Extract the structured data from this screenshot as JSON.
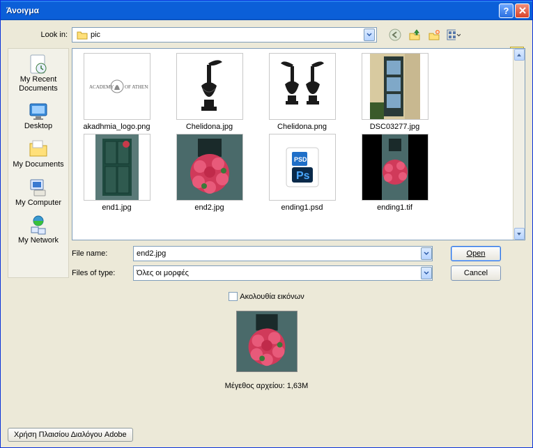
{
  "window": {
    "title": "Άνοιγμα"
  },
  "lookin": {
    "label": "Look in:",
    "value": "pic"
  },
  "places": {
    "recent": "My Recent\nDocuments",
    "desktop": "Desktop",
    "mydocs": "My Documents",
    "mycomp": "My Computer",
    "mynet": "My Network"
  },
  "files": [
    {
      "name": "akadhmia_logo.png"
    },
    {
      "name": "Chelidona.jpg"
    },
    {
      "name": "Chelidona.png"
    },
    {
      "name": "DSC03277.jpg"
    },
    {
      "name": "end1.jpg"
    },
    {
      "name": "end2.jpg"
    },
    {
      "name": "ending1.psd"
    },
    {
      "name": "ending1.tif"
    }
  ],
  "fields": {
    "filename_label": "File name:",
    "filename_value": "end2.jpg",
    "filetype_label": "Files of type:",
    "filetype_value": "Όλες οι μορφές"
  },
  "buttons": {
    "open": "Open",
    "cancel": "Cancel",
    "adobe": "Χρήση Πλαισίου Διαλόγου Adobe"
  },
  "sequence": {
    "label": "Ακολουθία εικόνων"
  },
  "filesize": {
    "label": "Μέγεθος αρχείου:",
    "value": "1,63M"
  },
  "icons": {
    "back": "back-icon",
    "up": "up-icon",
    "newfolder": "newfolder-icon",
    "viewmenu": "viewmenu-icon",
    "star": "star-icon"
  }
}
